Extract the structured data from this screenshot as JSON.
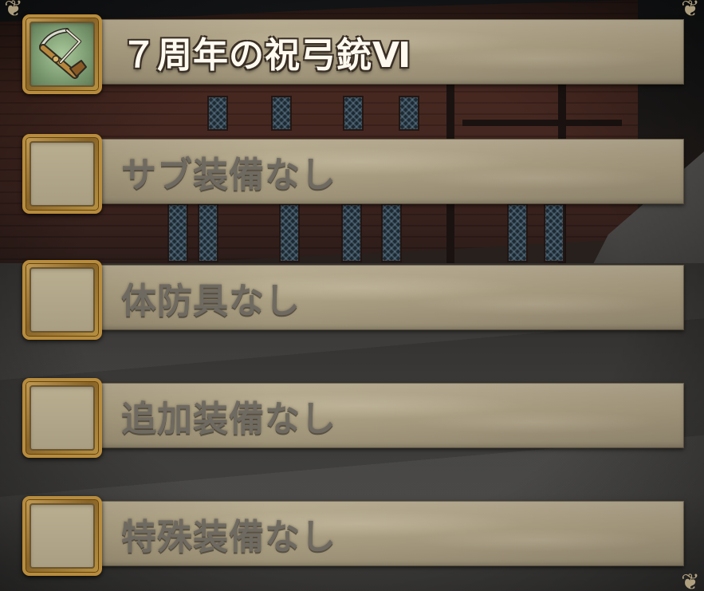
{
  "equipment_slots": [
    {
      "label": "７周年の祝弓銃Ⅵ",
      "equipped": true,
      "icon": "crossbow-icon"
    },
    {
      "label": "サブ装備なし",
      "equipped": false
    },
    {
      "label": "体防具なし",
      "equipped": false
    },
    {
      "label": "追加装備なし",
      "equipped": false
    },
    {
      "label": "特殊装備なし",
      "equipped": false
    }
  ],
  "colors": {
    "equipped_text": "#fffaf0",
    "empty_text": "#6f6a61",
    "slot_bar": "#aa9e82",
    "frame_gold": "#b88c3c"
  }
}
